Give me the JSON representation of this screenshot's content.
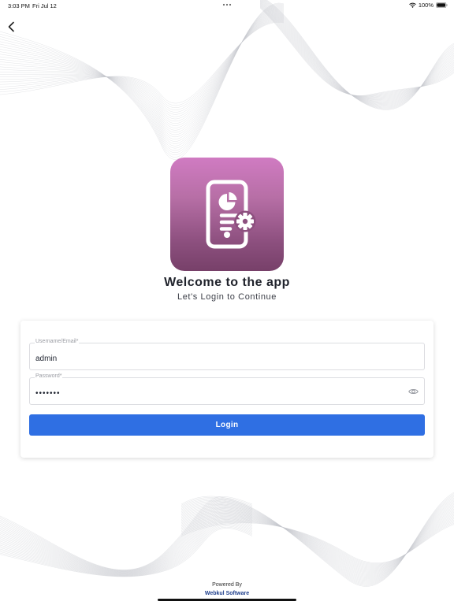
{
  "status_bar": {
    "time": "3:03 PM",
    "date": "Fri Jul 12",
    "battery": "100%"
  },
  "icons": {
    "back": "chevron-left-icon",
    "wifi": "wifi-icon",
    "battery": "battery-icon",
    "app_logo": "phone-analytics-settings-icon",
    "show_password": "eye-icon"
  },
  "header": {
    "title": "Welcome to the app",
    "subtitle": "Let's Login to Continue"
  },
  "form": {
    "username": {
      "label": "Username/Email*",
      "value": "admin"
    },
    "password": {
      "label": "Password*",
      "value": "•••••••"
    },
    "login_label": "Login"
  },
  "footer": {
    "powered_by": "Powered By",
    "company": "Webkul Software"
  },
  "colors": {
    "primary_button": "#2f6fe3",
    "logo_gradient_top": "#d07bc2",
    "logo_gradient_bottom": "#774069",
    "company_text": "#1f3f8c"
  }
}
